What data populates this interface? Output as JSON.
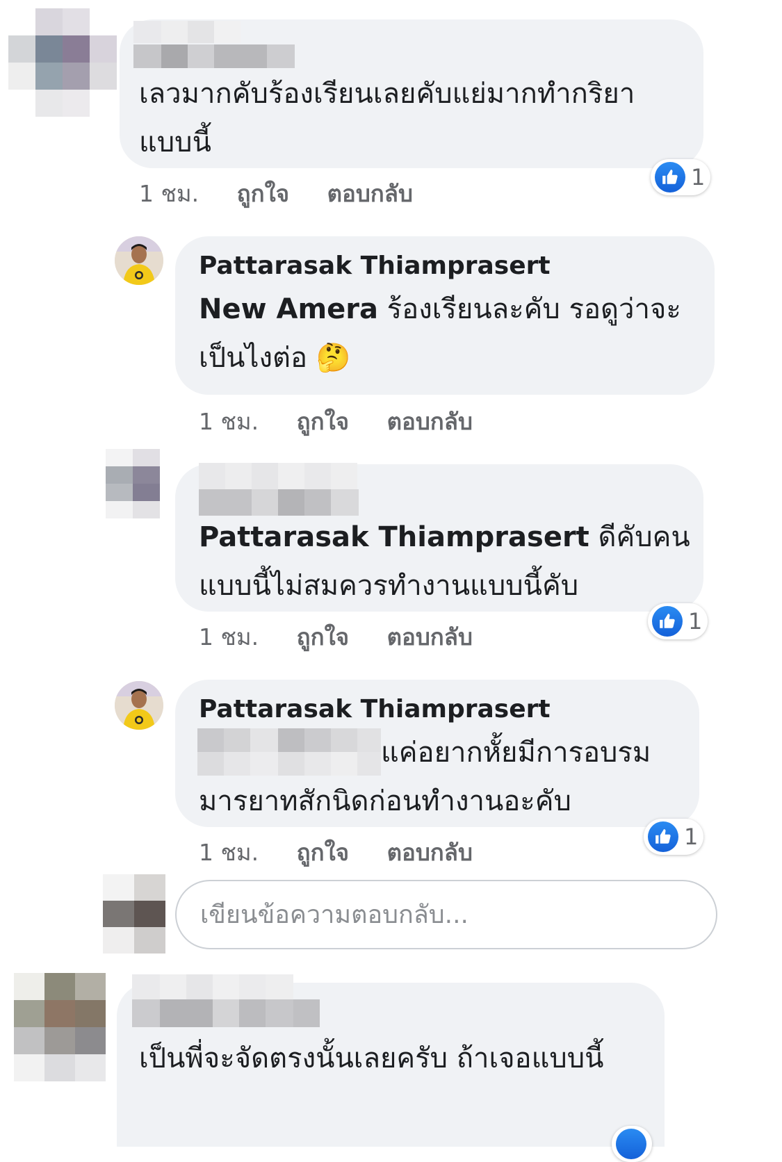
{
  "comments": [
    {
      "text_lines": [
        "เลวมากคับร้องเรียนเลยคับแย่มากทำกริยา",
        "แบบนี้"
      ],
      "time": "1 ชม.",
      "like_label": "ถูกใจ",
      "reply_label": "ตอบกลับ",
      "reaction_count": "1"
    },
    {
      "author": "Pattarasak Thiamprasert",
      "mention": "New Amera",
      "text_line1_rest": " ร้องเรียนละคับ รอดูว่าจะ",
      "text_line2": "เป็นไงต่อ",
      "emoji": "🤔",
      "time": "1 ชม.",
      "like_label": "ถูกใจ",
      "reply_label": "ตอบกลับ"
    },
    {
      "mention": "Pattarasak Thiamprasert",
      "text_line1_rest": " ดีคับคน",
      "text_line2": "แบบนี้ไม่สมควรทำงานแบบนี้คับ",
      "time": "1 ชม.",
      "like_label": "ถูกใจ",
      "reply_label": "ตอบกลับ",
      "reaction_count": "1"
    },
    {
      "author": "Pattarasak Thiamprasert",
      "text_line1_rest": "แค่อยากหั้ยมีการอบรม",
      "text_line2": "มารยาทสักนิดก่อนทำงานอะคับ",
      "time": "1 ชม.",
      "like_label": "ถูกใจ",
      "reply_label": "ตอบกลับ",
      "reaction_count": "1"
    }
  ],
  "reply_input": {
    "placeholder": "เขียนข้อความตอบกลับ..."
  },
  "next_comment": {
    "text": "เป็นพี่จะจัดตรงนั้นเลยครับ ถ้าเจอแบบนี้"
  },
  "colors": {
    "bubble": "#f0f2f5",
    "meta": "#65676b",
    "like_blue": "#1877f2"
  },
  "icons": {
    "reaction": "thumbs-up-icon"
  }
}
